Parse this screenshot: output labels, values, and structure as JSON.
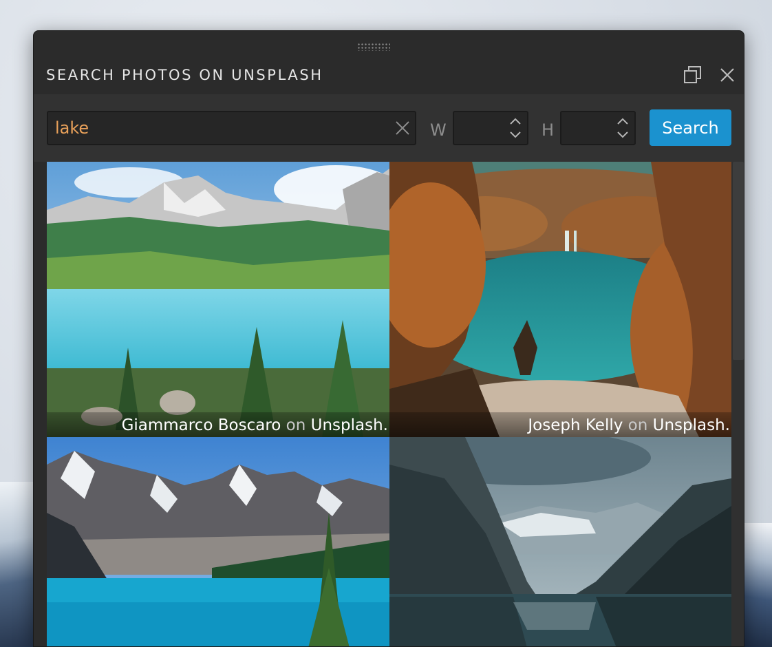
{
  "dialog": {
    "title": "SEARCH PHOTOS ON UNSPLASH",
    "restore_icon": "restore-window-icon",
    "close_icon": "close-icon"
  },
  "search": {
    "query": "lake",
    "clear_icon": "clear-x-icon",
    "width_label": "W",
    "height_label": "H",
    "width_value": "",
    "height_value": "",
    "button_label": "Search",
    "accent_color": "#1b92cf",
    "query_color": "#e9a15a"
  },
  "results": [
    {
      "author": "Giammarco Boscaro",
      "on": "on",
      "site": "Unsplash."
    },
    {
      "author": "Joseph Kelly",
      "on": "on",
      "site": "Unsplash."
    },
    {
      "author": "",
      "on": "",
      "site": ""
    },
    {
      "author": "",
      "on": "",
      "site": ""
    }
  ]
}
